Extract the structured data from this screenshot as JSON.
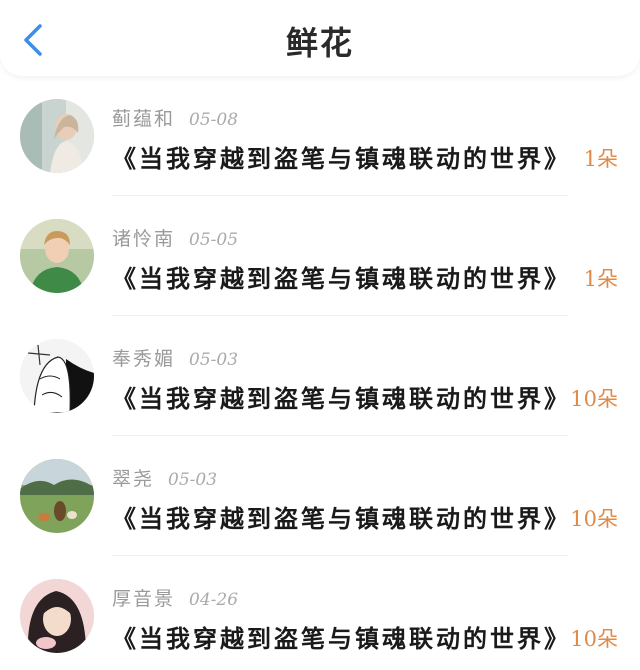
{
  "header": {
    "title": "鲜花",
    "back_icon": "chevron-left-icon",
    "accent_color": "#3d8ee8"
  },
  "items": [
    {
      "name": "蓟蕴和",
      "date": "05-08",
      "book": "《当我穿越到盗笔与镇魂联动的世界》",
      "count": "1朵"
    },
    {
      "name": "诸怜南",
      "date": "05-05",
      "book": "《当我穿越到盗笔与镇魂联动的世界》",
      "count": "1朵"
    },
    {
      "name": "奉秀媚",
      "date": "05-03",
      "book": "《当我穿越到盗笔与镇魂联动的世界》",
      "count": "10朵"
    },
    {
      "name": "翠尧",
      "date": "05-03",
      "book": "《当我穿越到盗笔与镇魂联动的世界》",
      "count": "10朵"
    },
    {
      "name": "厚音景",
      "date": "04-26",
      "book": "《当我穿越到盗笔与镇魂联动的世界》",
      "count": "10朵"
    }
  ],
  "colors": {
    "count": "#e08b4a",
    "name": "#9a9a9a",
    "book": "#1a1a1a"
  }
}
